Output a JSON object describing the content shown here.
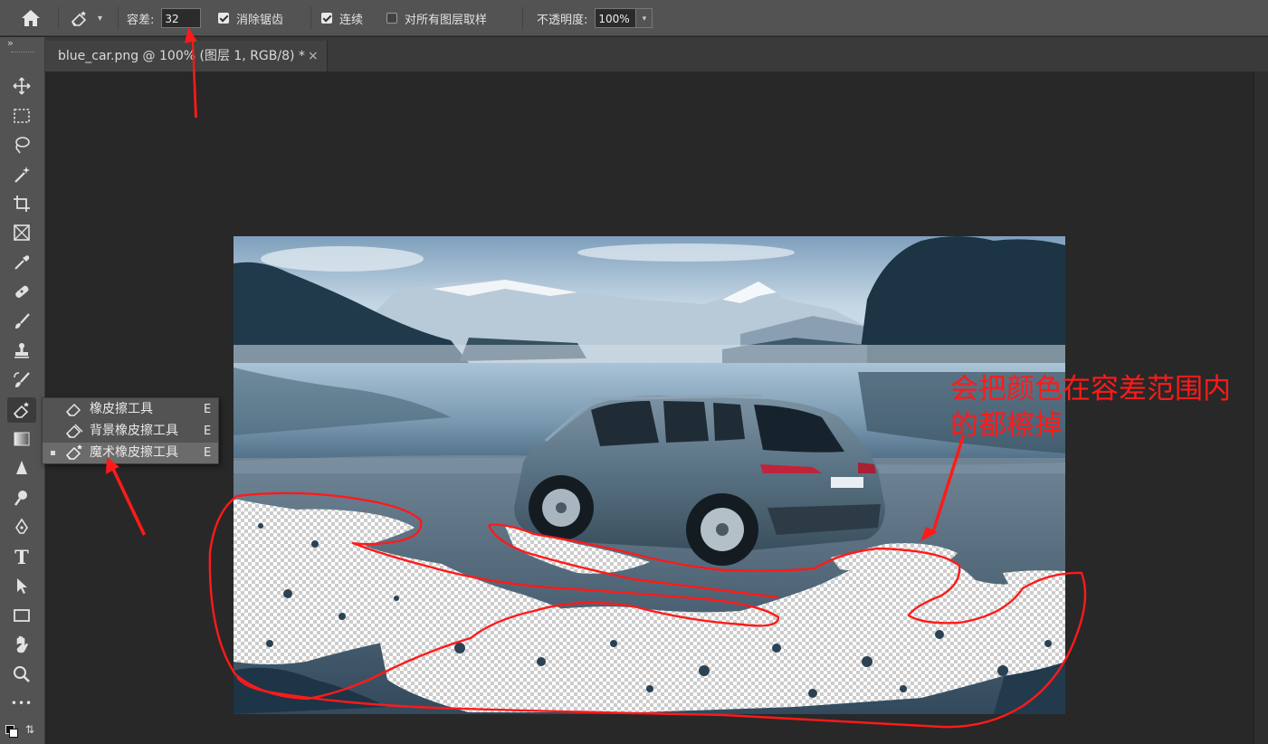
{
  "options_bar": {
    "home_icon": "home-icon",
    "tool_preset_icon": "magic-eraser-icon",
    "tolerance_label": "容差:",
    "tolerance_value": "32",
    "antialias_label": "消除锯齿",
    "antialias_checked": true,
    "contiguous_label": "连续",
    "contiguous_checked": true,
    "sample_all_layers_label": "对所有图层取样",
    "sample_all_layers_checked": false,
    "opacity_label": "不透明度:",
    "opacity_value": "100%"
  },
  "document_tab": {
    "title": "blue_car.png @ 100% (图层 1, RGB/8) *",
    "close_glyph": "×"
  },
  "toolbar": {
    "collapse_glyph": "»",
    "tools": [
      "move-icon",
      "marquee-icon",
      "lasso-icon",
      "magic-wand-icon",
      "crop-icon",
      "frame-icon",
      "eyedropper-icon",
      "healing-brush-icon",
      "brush-icon",
      "clone-stamp-icon",
      "history-brush-icon",
      "eraser-icon",
      "gradient-icon",
      "blur-icon",
      "dodge-icon",
      "pen-icon",
      "type-icon",
      "path-selection-icon",
      "rectangle-icon",
      "hand-icon",
      "zoom-icon",
      "more-icon"
    ],
    "more_glyph": "•••",
    "type_glyph": "T"
  },
  "flyout": {
    "items": [
      {
        "label": "橡皮擦工具",
        "key": "E",
        "icon": "eraser-icon",
        "selected": false
      },
      {
        "label": "背景橡皮擦工具",
        "key": "E",
        "icon": "background-eraser-icon",
        "selected": false
      },
      {
        "label": "魔术橡皮擦工具",
        "key": "E",
        "icon": "magic-eraser-icon",
        "selected": true
      }
    ]
  },
  "annotation": {
    "line1": "会把颜色在容差范围内",
    "line2": "的都檫掉",
    "color": "#ff1a1a"
  },
  "colors": {
    "panel": "#535353",
    "canvas": "#282828",
    "annotation_red": "#ff1a1a"
  }
}
